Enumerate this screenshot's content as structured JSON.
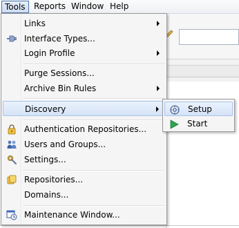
{
  "menubar": {
    "items": [
      {
        "label": "Tools",
        "active": true
      },
      {
        "label": "Reports"
      },
      {
        "label": "Window"
      },
      {
        "label": "Help"
      }
    ]
  },
  "tools_menu": {
    "items": [
      {
        "label": "Links",
        "submenu": true,
        "icon": null
      },
      {
        "label": "Interface Types...",
        "icon": "plug-icon"
      },
      {
        "label": "Login Profile",
        "submenu": true,
        "icon": null
      },
      {
        "label": "Purge Sessions...",
        "icon": null
      },
      {
        "label": "Archive Bin Rules",
        "submenu": true,
        "icon": null
      },
      {
        "label": "Discovery",
        "submenu": true,
        "highlighted": true,
        "icon": null
      },
      {
        "label": "Authentication Repositories...",
        "icon": "lock-icon"
      },
      {
        "label": "Users and Groups...",
        "icon": "users-icon"
      },
      {
        "label": "Settings...",
        "icon": "settings-icon"
      },
      {
        "label": "Repositories...",
        "icon": "repository-icon"
      },
      {
        "label": "Domains...",
        "icon": null
      },
      {
        "label": "Maintenance Window...",
        "icon": "maintenance-window-icon"
      }
    ]
  },
  "discovery_submenu": {
    "items": [
      {
        "label": "Setup",
        "icon": "setup-gear-icon",
        "highlighted": true
      },
      {
        "label": "Start",
        "icon": "play-icon"
      }
    ]
  },
  "colors": {
    "highlight_border": "#a8c2e6",
    "menu_background": "#f5f5f5",
    "play_green": "#2ea44f"
  }
}
